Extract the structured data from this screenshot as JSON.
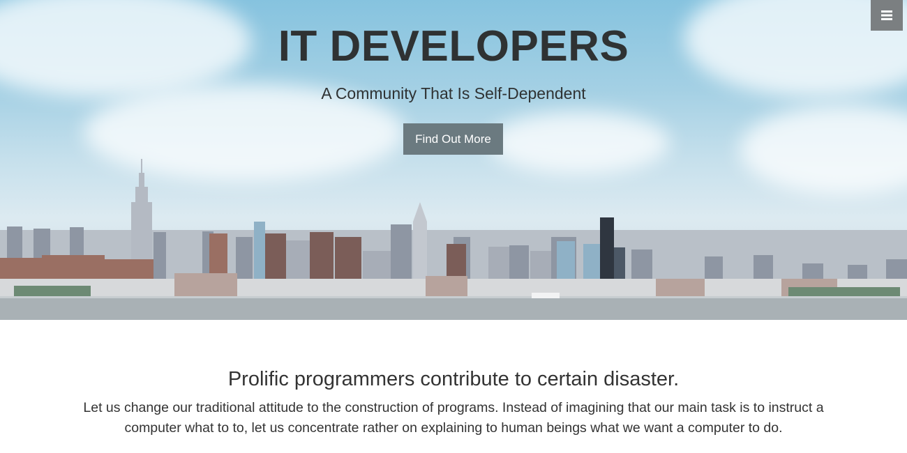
{
  "hero": {
    "title": "IT DEVELOPERS",
    "subtitle": "A Community That Is Self-Dependent",
    "cta_label": "Find Out More"
  },
  "nav": {
    "menu_icon": "hamburger-menu-icon"
  },
  "intro": {
    "heading": "Prolific programmers contribute to certain disaster.",
    "text": "Let us change our traditional attitude to the construction of programs. Instead of imagining that our main task is to instruct a computer what to to, let us concentrate rather on explaining to human beings what we want a computer to do."
  },
  "colors": {
    "sky": "#a4d0e4",
    "button_bg": "#6b7a80",
    "menu_bg": "#7b7f81",
    "text": "#333333",
    "water": "#a6aeb2"
  }
}
